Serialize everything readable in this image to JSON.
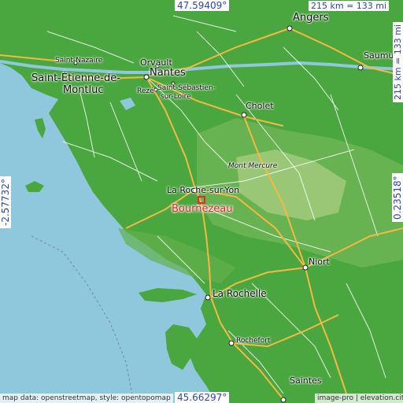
{
  "colors": {
    "sea": "#8fc8dd",
    "land": "#4aa63f",
    "road_major": "#f4b940",
    "road_minor": "#ffffff",
    "marker": "#e8262b",
    "coord_text": "#2a45b8"
  },
  "map": {
    "location_label": "Bournezeau",
    "location_icon": "square-marker-icon",
    "coords": {
      "top": "47.59409°",
      "bottom": "45.66297°",
      "left": "-2.57732°",
      "right": "0.23518°"
    },
    "scale": {
      "horizontal": "215 km = 133 mi",
      "vertical": "215 km = 133 mi"
    },
    "attribution_left": "map data: openstreetmap, style: opentopomap",
    "attribution_right": "image-pro | elevation.city",
    "cities": [
      {
        "name": "Angers"
      },
      {
        "name": "Saint-Nazaire"
      },
      {
        "name": "Orvault"
      },
      {
        "name": "Nantes"
      },
      {
        "name": "Saint-Étienne-de-"
      },
      {
        "name": "Montluc"
      },
      {
        "name": "Rezé"
      },
      {
        "name": "Saint-Sébastien-"
      },
      {
        "name": "sur-Loire"
      },
      {
        "name": "Cholet"
      },
      {
        "name": "Saumur"
      },
      {
        "name": "Mont Mercure"
      },
      {
        "name": "La Roche-sur-Yon"
      },
      {
        "name": "Niort"
      },
      {
        "name": "La Rochelle"
      },
      {
        "name": "Rochefort"
      },
      {
        "name": "Saintes"
      }
    ]
  }
}
